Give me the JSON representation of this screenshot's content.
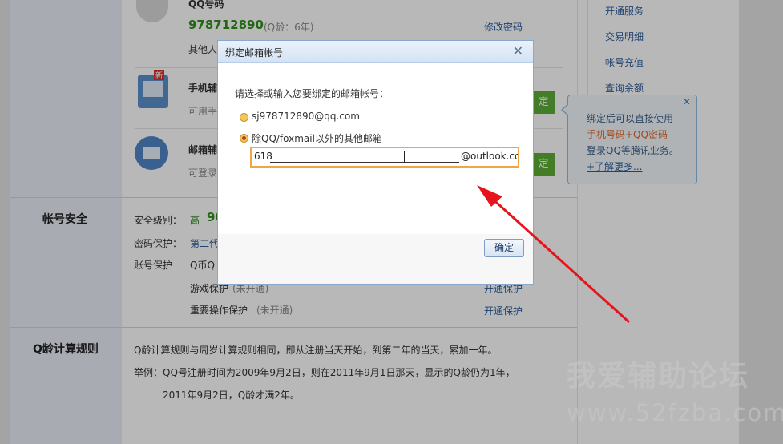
{
  "right_nav": {
    "items": [
      "开通服务",
      "交易明细",
      "帐号充值",
      "查询余额"
    ]
  },
  "qq_account": {
    "title": "QQ号码",
    "number": "978712890",
    "age": "(Q龄：6年)",
    "edit_link": "修改密码",
    "other_text": "其他人"
  },
  "phone_bind": {
    "title": "手机辅",
    "desc": "可用手",
    "badge": "新",
    "btn": "定"
  },
  "mail_bind": {
    "title": "邮箱辅",
    "desc": "可登录",
    "btn": "定"
  },
  "security": {
    "title": "帐号安全",
    "level_label": "安全级别：",
    "level_value": "高",
    "level_score": "90",
    "pwd_label": "密码保护：",
    "pwd_value": "第二代",
    "acct_label": "账号保护",
    "acct_value": "Q币Q",
    "game_label": "游戏保护",
    "game_status": "(未开通)",
    "game_link": "开通保护",
    "important_label": "重要操作保护",
    "important_status": "(未开通)",
    "important_link": "开通保护"
  },
  "qage_rules": {
    "title": "Q龄计算规则",
    "line1": "Q龄计算规则与周岁计算规则相同，即从注册当天开始，到第二年的当天，累加一年。",
    "line2": "举例：QQ号注册时间为2009年9月2日，则在2011年9月1日那天，显示的Q龄仍为1年，",
    "line3": "2011年9月2日，Q龄才满2年。"
  },
  "popup": {
    "line1": "绑定后可以直接使用",
    "line2": "手机号码+QQ密码",
    "line3": "登录QQ等腾讯业务。",
    "link": "+了解更多...",
    "close": "✕"
  },
  "dialog": {
    "title": "绑定邮箱帐号",
    "close": "✕",
    "prompt": "请选择或输入您要绑定的邮箱帐号：",
    "option1": "sj978712890@qq.com",
    "option2": "除QQ/foxmail以外的其他邮箱",
    "input_prefix": "618",
    "input_suffix": "@outlook.co",
    "ok": "确定"
  },
  "watermark": {
    "line1": "我爱辅助论坛",
    "line2": "www.52fzba.com"
  },
  "colors": {
    "accent_green": "#2f8f1c",
    "link_blue": "#2b5d9b",
    "arrow_red": "#e8141b",
    "popup_orange": "#e0662b"
  }
}
